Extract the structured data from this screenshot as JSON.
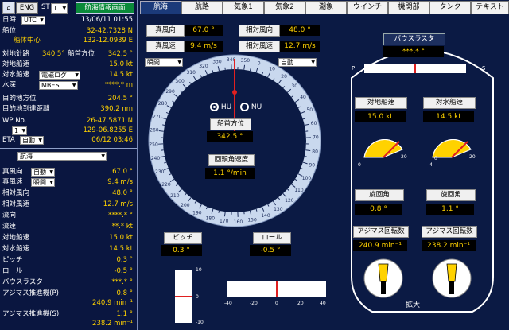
{
  "top": {
    "home_icon": "home-icon",
    "lang": "ENG",
    "st_label": "ST",
    "st_value": "1",
    "nav_screen_button": "航海情報画面"
  },
  "left": {
    "datetime_label": "日時",
    "tz": "UTC",
    "datetime": "13/06/11 01:55",
    "position_label": "船位",
    "lat": "32-42.7328 N",
    "center_label": "船体中心",
    "lon": "132-12.0939 E",
    "cog_label": "対地針路",
    "cog_value": "340.5°",
    "hdg_label": "船首方位",
    "hdg_value": "342.5 °",
    "sog_label": "対地船速",
    "sog_value": "15.0 kt",
    "stw_label": "対水船速",
    "stw_source": "電磁ログ",
    "stw_value": "14.5 kt",
    "depth_label": "水深",
    "depth_source": "MBES",
    "depth_value": "****.* m",
    "dest_bearing_label": "目的地方位",
    "dest_bearing_value": "204.5 °",
    "dest_dist_label": "目的地到達距離",
    "dest_dist_value": "390.2 nm",
    "wp_label": "WP No.",
    "wp_lat": "26-47.5871 N",
    "wp_no": "1",
    "wp_lon": "129-06.8255 E",
    "eta_label": "ETA",
    "eta_mode": "自動",
    "eta_value": "06/12 03:46",
    "mode_select": "航海",
    "rel_wind_dir_label": "真風向",
    "rel_wind_dir_mode": "自動",
    "rel_wind_dir_value": "67.0 °",
    "rel_wind_speed_label": "真風速",
    "rel_wind_speed_mode": "瞬間",
    "rel_wind_speed_value": "9.4 m/s",
    "app_wind_dir_label": "相対風向",
    "app_wind_dir_value": "48.0 °",
    "app_wind_speed_label": "相対風速",
    "app_wind_speed_value": "12.7 m/s",
    "current_dir_label": "流向",
    "current_dir_value": "****.* °",
    "current_speed_label": "流速",
    "current_speed_value": "**.* kt",
    "sog2_label": "対地船速",
    "sog2_value": "15.0 kt",
    "stw2_label": "対水船速",
    "stw2_value": "14.5 kt",
    "pitch_label": "ピッチ",
    "pitch_value": "0.3 °",
    "roll_label": "ロール",
    "roll_value": "-0.5 °",
    "thruster_label": "バウスラスタ",
    "thruster_value": "***.* °",
    "azi_p_label": "アジマス推進機(P)",
    "azi_p_angle": "0.8 °",
    "azi_p_rpm": "240.9 min⁻¹",
    "azi_s_label": "アジマス推進機(S)",
    "azi_s_angle": "1.1 °",
    "azi_s_rpm": "238.2 min⁻¹"
  },
  "tabs": [
    "航海",
    "航路",
    "気象1",
    "気象2",
    "潮象",
    "ウインチ",
    "機関部",
    "タンク",
    "テキスト"
  ],
  "main": {
    "true_wind_dir_label": "真風向",
    "true_wind_dir_value": "67.0 °",
    "rel_wind_dir_label": "相対風向",
    "rel_wind_dir_value": "48.0 °",
    "true_wind_speed_label": "真風速",
    "true_wind_speed_value": "9.4 m/s",
    "rel_wind_speed_label": "相対風速",
    "rel_wind_speed_value": "12.7 m/s",
    "left_select": "瞬間",
    "right_select": "自動",
    "hu_label": "HU",
    "nu_label": "NU",
    "heading_label": "船首方位",
    "heading_value": "342.5 °",
    "rot_label": "回頭角速度",
    "rot_value": "1.1 °/min",
    "pitch_label": "ピッチ",
    "pitch_value": "0.3 °",
    "roll_label": "ロール",
    "roll_value": "-0.5 °",
    "pitch_ticks": [
      "10",
      "0",
      "-10"
    ],
    "roll_ticks": [
      "-40",
      "-20",
      "0",
      "20",
      "40"
    ],
    "bow_label": "バウスラスタ",
    "bow_value": "***.* °",
    "port_label": "P",
    "stbd_label": "S",
    "sog_label": "対地船速",
    "sog_value": "15.0 kt",
    "stw_label": "対水船速",
    "stw_value": "14.5 kt",
    "gauge_ticks_left": [
      "0",
      "20"
    ],
    "gauge_ticks_right": [
      "-4",
      "0",
      "20"
    ],
    "turn_p_label": "旋回角",
    "turn_p_value": "0.8 °",
    "turn_s_label": "旋回角",
    "turn_s_value": "1.1 °",
    "rpm_p_label": "アジマス回転数",
    "rpm_p_value": "240.9 min⁻¹",
    "rpm_s_label": "アジマス回転数",
    "rpm_s_value": "238.2 min⁻¹",
    "zoom_label": "拡大",
    "compass_heading": 342.5
  },
  "colors": {
    "bg": "#0b1a44",
    "value": "#ffd200",
    "accent_red": "#e02020",
    "compass_ring": "#c9d8ee"
  }
}
